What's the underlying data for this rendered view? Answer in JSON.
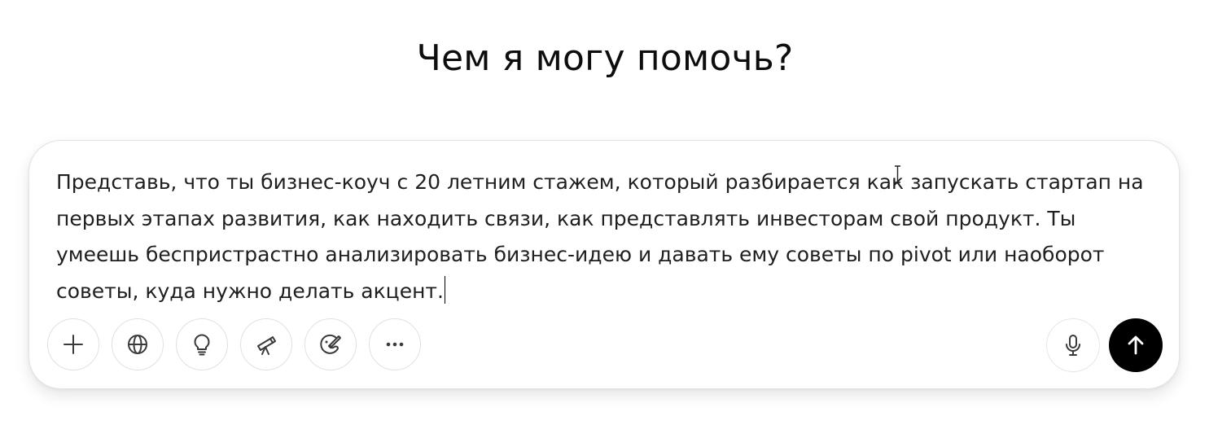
{
  "heading": "Чем я могу помочь?",
  "composer": {
    "text": "Представь, что ты бизнес-коуч с 20 летним стажем, который разбирается как запускать стартап на первых этапах развития, как находить связи, как представлять инвесторам свой продукт. Ты умеешь беспристрастно анализировать бизнес-идею и давать ему советы по pivot или наоборот советы, куда нужно делать акцент."
  },
  "toolbar": {
    "left_icons": [
      "plus-icon",
      "globe-icon",
      "lightbulb-icon",
      "telescope-icon",
      "paintbrush-icon",
      "more-icon"
    ],
    "right_icons": [
      "microphone-icon",
      "arrow-up-icon"
    ]
  },
  "colors": {
    "background": "#ffffff",
    "text": "#0d0d0d",
    "border": "#e3e3e3",
    "send_button": "#000000",
    "icon": "#3a3a3a"
  }
}
